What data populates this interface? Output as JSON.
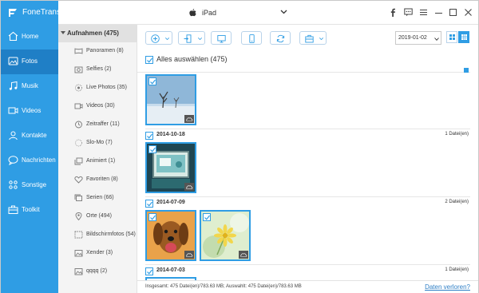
{
  "app": {
    "name": "FoneTrans",
    "device": "iPad"
  },
  "nav": [
    {
      "label": "Home",
      "icon": "home-icon"
    },
    {
      "label": "Fotos",
      "icon": "photo-icon",
      "active": true
    },
    {
      "label": "Musik",
      "icon": "music-icon"
    },
    {
      "label": "Videos",
      "icon": "video-icon"
    },
    {
      "label": "Kontakte",
      "icon": "contacts-icon"
    },
    {
      "label": "Nachrichten",
      "icon": "messages-icon"
    },
    {
      "label": "Sonstige",
      "icon": "other-icon"
    },
    {
      "label": "Toolkit",
      "icon": "toolkit-icon"
    }
  ],
  "albums": {
    "header": "Aufnahmen (475)",
    "items": [
      {
        "label": "Panoramen (8)",
        "icon": "panorama-icon"
      },
      {
        "label": "Selfies (2)",
        "icon": "selfie-icon"
      },
      {
        "label": "Live Photos (35)",
        "icon": "live-photo-icon"
      },
      {
        "label": "Videos (30)",
        "icon": "video-icon"
      },
      {
        "label": "Zeitraffer (11)",
        "icon": "timelapse-icon"
      },
      {
        "label": "Slo-Mo (7)",
        "icon": "slomo-icon"
      },
      {
        "label": "Animiert (1)",
        "icon": "animated-icon"
      },
      {
        "label": "Favoriten (8)",
        "icon": "heart-icon"
      },
      {
        "label": "Serien (66)",
        "icon": "burst-icon"
      },
      {
        "label": "Orte (494)",
        "icon": "location-icon"
      },
      {
        "label": "Bildschirmfotos (54)",
        "icon": "screenshot-icon"
      },
      {
        "label": "Xender (3)",
        "icon": "folder-icon"
      },
      {
        "label": "qqqq (2)",
        "icon": "folder-icon"
      }
    ]
  },
  "toolbar": {
    "date_value": "2019-01-02"
  },
  "select_all_label": "Alles auswählen (475)",
  "groups": [
    {
      "date": "2014-10-18",
      "count": "1 Datei(en)"
    },
    {
      "date": "2014-07-09",
      "count": "2 Datei(en)"
    },
    {
      "date": "2014-07-03",
      "count": "1 Datei(en)"
    }
  ],
  "status": {
    "info": "Insgesamt: 475 Datei(en)/783.63 MB; Auswahlt: 475 Datei(en)/783.63 MB",
    "link": "Daten verloren?"
  },
  "colors": {
    "accent": "#2f9de4",
    "nav_active": "#1f7fc6"
  }
}
